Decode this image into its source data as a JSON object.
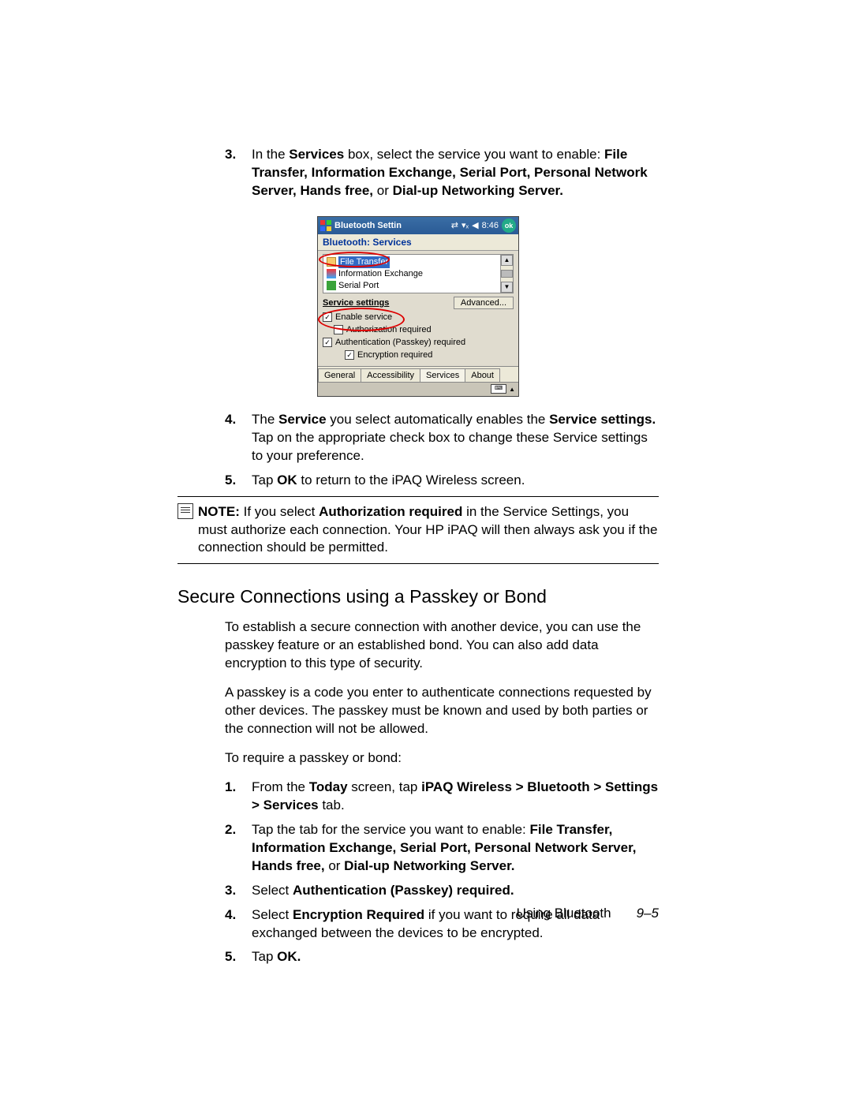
{
  "steps_a": {
    "n3": "3.",
    "t3_pre": "In the ",
    "t3_b1": "Services",
    "t3_mid": " box, select the service you want to enable: ",
    "t3_b2": "File Transfer, Information Exchange, Serial Port, Personal Network Server, Hands free,",
    "t3_or": " or ",
    "t3_b3": "Dial-up Networking Server.",
    "n4": "4.",
    "t4_pre": "The ",
    "t4_b1": "Service",
    "t4_mid1": " you select automatically enables the ",
    "t4_b2": "Service settings.",
    "t4_mid2": " Tap on the appropriate check box to change these Service settings to your preference.",
    "n5": "5.",
    "t5_pre": "Tap ",
    "t5_b1": "OK",
    "t5_post": " to return to the iPAQ Wireless screen."
  },
  "device": {
    "title": "Bluetooth Settin",
    "time": "8:46",
    "ok": "ok",
    "subheader": "Bluetooth: Services",
    "svc1": "File Transfer",
    "svc2": "Information Exchange",
    "svc3": "Serial Port",
    "settings_label": "Service settings",
    "advanced": "Advanced...",
    "chk1": "Enable service",
    "chk2": "Authorization required",
    "chk3": "Authentication (Passkey) required",
    "chk4": "Encryption required",
    "tab1": "General",
    "tab2": "Accessibility",
    "tab3": "Services",
    "tab4": "About",
    "scroll_up": "▲",
    "scroll_down": "▼"
  },
  "note": {
    "pre": "NOTE:",
    "mid1": " If you select ",
    "b1": "Authorization required",
    "post": " in the Service Settings, you must authorize each connection. Your HP iPAQ will then always ask you if the connection should be permitted."
  },
  "section_title": "Secure Connections using a Passkey or Bond",
  "paras": {
    "p1": "To establish a secure connection with another device, you can use the passkey feature or an established bond. You can also add data encryption to this type of security.",
    "p2": "A passkey is a code you enter to authenticate connections requested by other devices. The passkey must be known and used by both parties or the connection will not be allowed.",
    "p3": "To require a passkey or bond:"
  },
  "steps_b": {
    "n1": "1.",
    "t1_pre": "From the ",
    "t1_b1": "Today",
    "t1_mid": " screen, tap ",
    "t1_b2": "iPAQ Wireless > Bluetooth > Settings > Services",
    "t1_post": " tab.",
    "n2": "2.",
    "t2_pre": "Tap the tab for the service you want to enable: ",
    "t2_b1": "File Transfer, Information Exchange, Serial Port, Personal Network Server, Hands free,",
    "t2_or": " or ",
    "t2_b2": "Dial-up Networking Server.",
    "n3": "3.",
    "t3_pre": "Select ",
    "t3_b1": "Authentication (Passkey) required.",
    "n4": "4.",
    "t4_pre": "Select ",
    "t4_b1": "Encryption Required",
    "t4_post": " if you want to require all data exchanged between the devices to be encrypted.",
    "n5": "5.",
    "t5_pre": "Tap ",
    "t5_b1": "OK."
  },
  "footer": {
    "chapter": "Using Bluetooth",
    "page": "9–5"
  }
}
